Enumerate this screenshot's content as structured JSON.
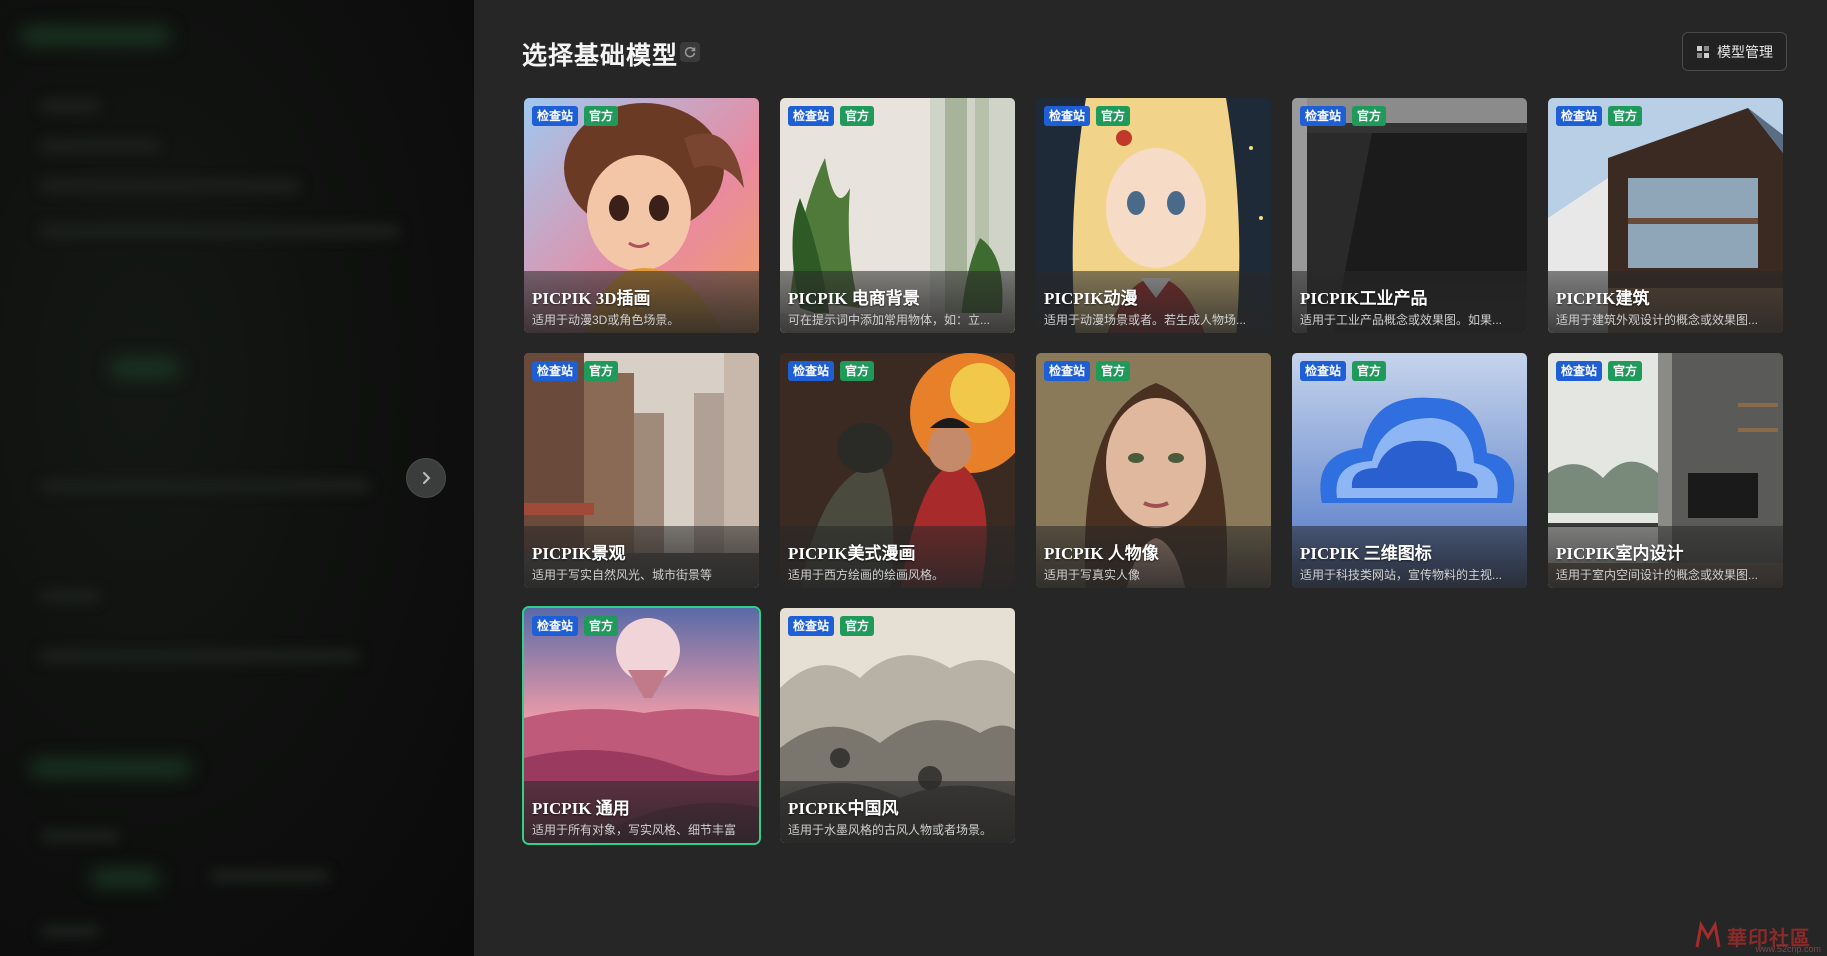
{
  "header": {
    "title": "选择基础模型",
    "manage_label": "模型管理"
  },
  "badges": {
    "check": "检查站",
    "official": "官方"
  },
  "models": [
    {
      "title": "PICPIK 3D插画",
      "desc": "适用于动漫3D或角色场景。",
      "art": "3d-girl",
      "selected": false
    },
    {
      "title": "PICPIK 电商背景",
      "desc": "可在提示词中添加常用物体，如：立...",
      "art": "ecommerce",
      "selected": false
    },
    {
      "title": "PICPIK动漫",
      "desc": "适用于动漫场景或者。若生成人物场...",
      "art": "anime",
      "selected": false
    },
    {
      "title": "PICPIK工业产品",
      "desc": "适用于工业产品概念或效果图。如果...",
      "art": "industrial",
      "selected": false
    },
    {
      "title": "PICPIK建筑",
      "desc": "适用于建筑外观设计的概念或效果图...",
      "art": "architecture",
      "selected": false
    },
    {
      "title": "PICPIK景观",
      "desc": "适用于写实自然风光、城市街景等",
      "art": "city",
      "selected": false
    },
    {
      "title": "PICPIK美式漫画",
      "desc": "适用于西方绘画的绘画风格。",
      "art": "comic",
      "selected": false
    },
    {
      "title": "PICPIK 人物像",
      "desc": "适用于写真实人像",
      "art": "portrait",
      "selected": false
    },
    {
      "title": "PICPIK 三维图标",
      "desc": "适用于科技类网站，宣传物料的主视...",
      "art": "cloud-icon",
      "selected": false
    },
    {
      "title": "PICPIK室内设计",
      "desc": "适用于室内空间设计的概念或效果图...",
      "art": "interior",
      "selected": false
    },
    {
      "title": "PICPIK 通用",
      "desc": "适用于所有对象，写实风格、细节丰富",
      "art": "desert-balloon",
      "selected": true
    },
    {
      "title": "PICPIK中国风",
      "desc": "适用于水墨风格的古风人物或者场景。",
      "art": "ink-landscape",
      "selected": false
    }
  ],
  "colors": {
    "check_badge": "#1f5fd6",
    "official_badge": "#1f9a5a",
    "selected_border": "#2fd18a",
    "background": "#262626"
  },
  "watermark": {
    "text": "華印社區",
    "url": "www.52cnp.com"
  }
}
